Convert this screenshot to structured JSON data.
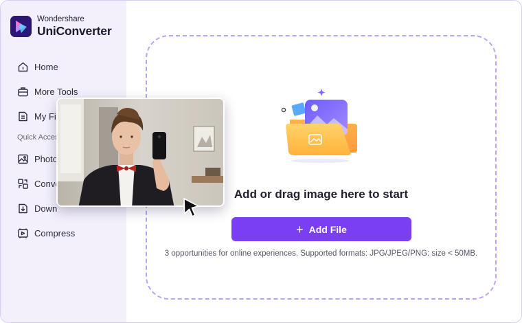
{
  "app": {
    "company": "Wondershare",
    "product": "UniConverter"
  },
  "sidebar": {
    "items": [
      {
        "label": "Home",
        "icon": "home-icon"
      },
      {
        "label": "More Tools",
        "icon": "toolbox-icon"
      },
      {
        "label": "My Fil",
        "icon": "files-icon"
      }
    ],
    "quick_access": {
      "title": "Quick Acces",
      "items": [
        {
          "label": "Photo",
          "icon": "image-icon"
        },
        {
          "label": "Conve",
          "icon": "convert-icon"
        },
        {
          "label": "Down",
          "icon": "download-icon"
        },
        {
          "label": "Compress",
          "icon": "compress-icon"
        }
      ]
    }
  },
  "main": {
    "drop_title": "Add or drag image here to start",
    "add_file_label": "Add File",
    "formats_note": "3 opportunities for online experiences. Supported formats: JPG/JPEG/PNG: size < 50MB."
  },
  "colors": {
    "accent": "#7a3ff2",
    "dashed_border": "#b9a3f2",
    "sidebar_bg": "#f3f0fb"
  }
}
